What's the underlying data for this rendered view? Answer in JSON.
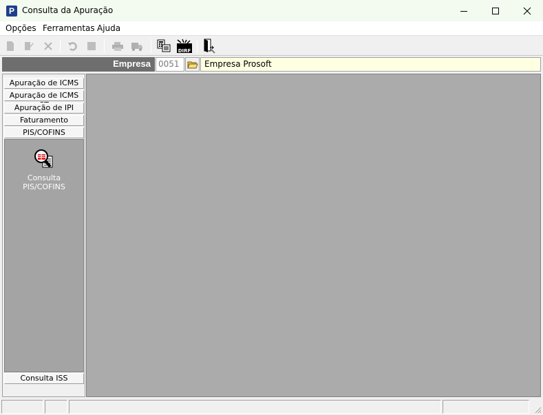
{
  "window": {
    "title": "Consulta da Apuração",
    "app_icon_glyph": "P",
    "accent_color": "#1f3f8c"
  },
  "menu": {
    "items": [
      {
        "label": "Opções"
      },
      {
        "label": "Ferramentas"
      },
      {
        "label": "Ajuda"
      }
    ]
  },
  "toolbar": {
    "buttons": [
      {
        "icon": "new-document-icon",
        "enabled": false
      },
      {
        "icon": "edit-document-icon",
        "enabled": false
      },
      {
        "icon": "delete-x-icon",
        "enabled": false
      },
      {
        "icon": "undo-icon",
        "enabled": false
      },
      {
        "icon": "stop-square-icon",
        "enabled": false
      },
      {
        "icon": "print-icon",
        "enabled": false
      },
      {
        "icon": "truck-icon",
        "enabled": false
      },
      {
        "icon": "report-calculator-icon",
        "enabled": true
      },
      {
        "icon": "dirf-report-icon",
        "enabled": true,
        "text": "DIRF"
      },
      {
        "icon": "exit-door-icon",
        "enabled": true
      }
    ]
  },
  "empresa": {
    "label": "Empresa",
    "code": "0051",
    "name": "Empresa Prosoft"
  },
  "sidebar": {
    "tabs": [
      {
        "label": "Apuração de ICMS"
      },
      {
        "label": "Apuração de ICMS ST"
      },
      {
        "label": "Apuração de IPI"
      },
      {
        "label": "Faturamento"
      },
      {
        "label": "PIS/COFINS"
      }
    ],
    "panel_item": {
      "icon": "magnifier-report-icon",
      "label_line1": "Consulta",
      "label_line2": "PIS/COFINS"
    },
    "bottom_tab": {
      "label": "Consulta ISS"
    }
  }
}
